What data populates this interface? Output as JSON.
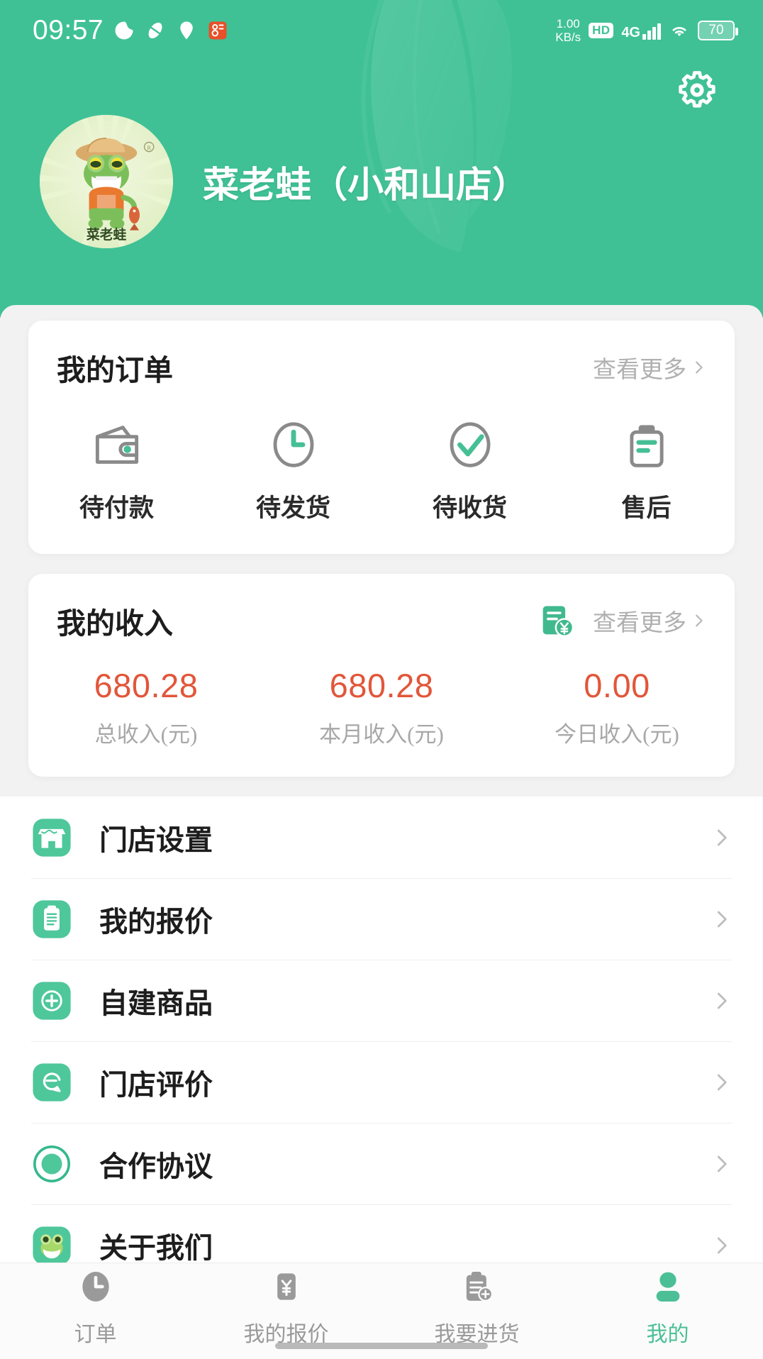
{
  "status_bar": {
    "time": "09:57",
    "net_speed_value": "1.00",
    "net_speed_unit": "KB/s",
    "hd": "HD",
    "network": "4G",
    "battery": "70",
    "left_icons": [
      "weather-icon",
      "capsule-icon",
      "location-icon",
      "app-badge-icon"
    ],
    "right_icons": [
      "wifi-icon",
      "signal-bars-icon",
      "battery-icon"
    ]
  },
  "header": {
    "store_name": "菜老蛙（小和山店）",
    "logo_caption": "菜老蛙",
    "settings_icon": "gear-icon",
    "background_color": "#3fc195"
  },
  "orders_card": {
    "title": "我的订单",
    "more_label": "查看更多",
    "items": [
      {
        "label": "待付款",
        "icon": "wallet-icon"
      },
      {
        "label": "待发货",
        "icon": "clock-icon"
      },
      {
        "label": "待收货",
        "icon": "check-circle-icon"
      },
      {
        "label": "售后",
        "icon": "clipboard-icon"
      }
    ]
  },
  "income_card": {
    "title": "我的收入",
    "more_label": "查看更多",
    "icon": "receipt-yuan-icon",
    "value_color": "#e2563a",
    "stats": [
      {
        "value": "680.28",
        "label": "总收入(元)"
      },
      {
        "value": "680.28",
        "label": "本月收入(元)"
      },
      {
        "value": "0.00",
        "label": "今日收入(元)"
      }
    ]
  },
  "menu": {
    "items": [
      {
        "label": "门店设置",
        "icon": "storefront-icon"
      },
      {
        "label": "我的报价",
        "icon": "quote-list-icon"
      },
      {
        "label": "自建商品",
        "icon": "plus-circle-icon"
      },
      {
        "label": "门店评价",
        "icon": "review-icon"
      },
      {
        "label": "合作协议",
        "icon": "agreement-radio-icon"
      },
      {
        "label": "关于我们",
        "icon": "frog-icon"
      }
    ]
  },
  "tabbar": {
    "active_color": "#4cbf96",
    "inactive_color": "#9a9a9a",
    "items": [
      {
        "label": "订单",
        "icon": "clock-filled-icon",
        "active": false
      },
      {
        "label": "我的报价",
        "icon": "yuan-card-icon",
        "active": false
      },
      {
        "label": "我要进货",
        "icon": "clipboard-plus-icon",
        "active": false
      },
      {
        "label": "我的",
        "icon": "person-icon",
        "active": true
      }
    ]
  }
}
